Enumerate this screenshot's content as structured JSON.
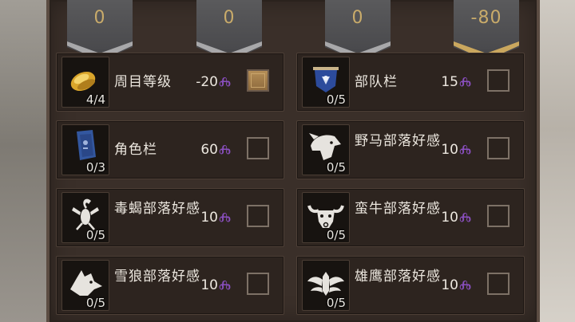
{
  "banners": [
    {
      "value": "0"
    },
    {
      "value": "0"
    },
    {
      "value": "0"
    },
    {
      "value": "-80"
    }
  ],
  "cards": [
    {
      "label": "周目等级",
      "count": "4/4",
      "cost": "-20",
      "checked": true,
      "icon": "gold-ingot-icon"
    },
    {
      "label": "部队栏",
      "count": "0/5",
      "cost": "15",
      "checked": false,
      "icon": "blue-banner-icon"
    },
    {
      "label": "角色栏",
      "count": "0/3",
      "cost": "60",
      "checked": false,
      "icon": "blue-scroll-icon"
    },
    {
      "label": "野马部落好感",
      "count": "0/5",
      "cost": "10",
      "checked": false,
      "icon": "wild-horse-emblem-icon"
    },
    {
      "label": "毒蝎部落好感",
      "count": "0/5",
      "cost": "10",
      "checked": false,
      "icon": "scorpion-emblem-icon"
    },
    {
      "label": "蛮牛部落好感",
      "count": "0/5",
      "cost": "10",
      "checked": false,
      "icon": "bull-emblem-icon"
    },
    {
      "label": "雪狼部落好感",
      "count": "0/5",
      "cost": "10",
      "checked": false,
      "icon": "wolf-emblem-icon"
    },
    {
      "label": "雄鹰部落好感",
      "count": "0/5",
      "cost": "10",
      "checked": false,
      "icon": "eagle-emblem-icon"
    }
  ],
  "colors": {
    "cost_mark": "#8a4fbf",
    "banner_text": "#c9ab6a",
    "checked_fill": "#b58e57"
  }
}
